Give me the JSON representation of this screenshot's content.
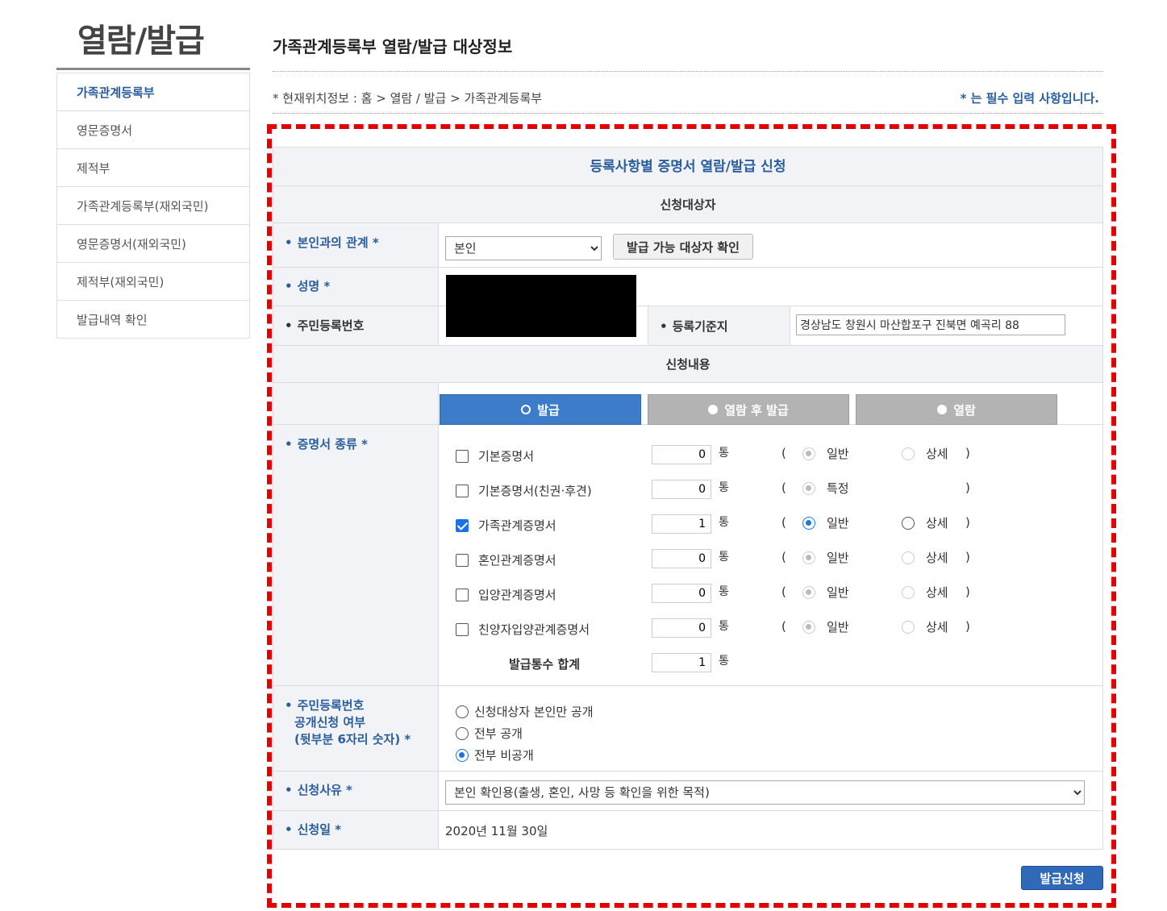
{
  "sidebar": {
    "title": "열람/발급",
    "items": [
      {
        "label": "가족관계등록부"
      },
      {
        "label": "영문증명서"
      },
      {
        "label": "제적부"
      },
      {
        "label": "가족관계등록부(재외국민)"
      },
      {
        "label": "영문증명서(재외국민)"
      },
      {
        "label": "제적부(재외국민)"
      },
      {
        "label": "발급내역 확인"
      }
    ]
  },
  "header": {
    "title": "가족관계등록부 열람/발급 대상정보",
    "location": "* 현재위치정보 : 홈 > 열람 / 발급 > 가족관계등록부",
    "required_note": "* 는 필수 입력 사항입니다."
  },
  "form": {
    "title": "등록사항별 증명서 열람/발급 신청",
    "section_applicant": "신청대상자",
    "relation": {
      "label": "본인과의 관계",
      "star": "*",
      "value": "본인",
      "check_button": "발급 가능 대상자 확인"
    },
    "name": {
      "label": "성명",
      "star": "*"
    },
    "rrn": {
      "label": "주민등록번호"
    },
    "base": {
      "label": "등록기준지",
      "value": "경상남도 창원시 마산합포구 진북면 예곡리 88"
    },
    "section_request": "신청내용",
    "tabs": [
      {
        "label": "발급",
        "active": true
      },
      {
        "label": "열람 후 발급",
        "active": false
      },
      {
        "label": "열람",
        "active": false
      }
    ],
    "cert_label": "증명서 종류",
    "cert_star": "*",
    "unit": "통",
    "paren_open": "(",
    "paren_close": ")",
    "certs": [
      {
        "name": "기본증명서",
        "checked": false,
        "count": "0",
        "opt1": "일반",
        "opt2": "상세"
      },
      {
        "name": "기본증명서(친권·후견)",
        "checked": false,
        "count": "0",
        "opt1": "특정",
        "opt2": ""
      },
      {
        "name": "가족관계증명서",
        "checked": true,
        "count": "1",
        "opt1": "일반",
        "opt2": "상세"
      },
      {
        "name": "혼인관계증명서",
        "checked": false,
        "count": "0",
        "opt1": "일반",
        "opt2": "상세"
      },
      {
        "name": "입양관계증명서",
        "checked": false,
        "count": "0",
        "opt1": "일반",
        "opt2": "상세"
      },
      {
        "name": "친양자입양관계증명서",
        "checked": false,
        "count": "0",
        "opt1": "일반",
        "opt2": "상세"
      }
    ],
    "total": {
      "label": "발급통수 합계",
      "value": "1"
    },
    "disclosure": {
      "label_lines": [
        "주민등록번호",
        "공개신청 여부",
        "(뒷부분 6자리 숫자) *"
      ],
      "options": [
        {
          "label": "신청대상자 본인만 공개",
          "selected": false
        },
        {
          "label": "전부 공개",
          "selected": false
        },
        {
          "label": "전부 비공개",
          "selected": true
        }
      ]
    },
    "reason": {
      "label": "신청사유",
      "star": "*",
      "value": "본인 확인용(출생, 혼인, 사망 등 확인을 위한 목적)"
    },
    "date": {
      "label": "신청일",
      "star": "*",
      "value": "2020년 11월 30일"
    },
    "submit": "발급신청"
  },
  "colors": {
    "accent": "#2a5d9b",
    "tab_active": "#3d7cc9",
    "highlight": "#e30000"
  }
}
